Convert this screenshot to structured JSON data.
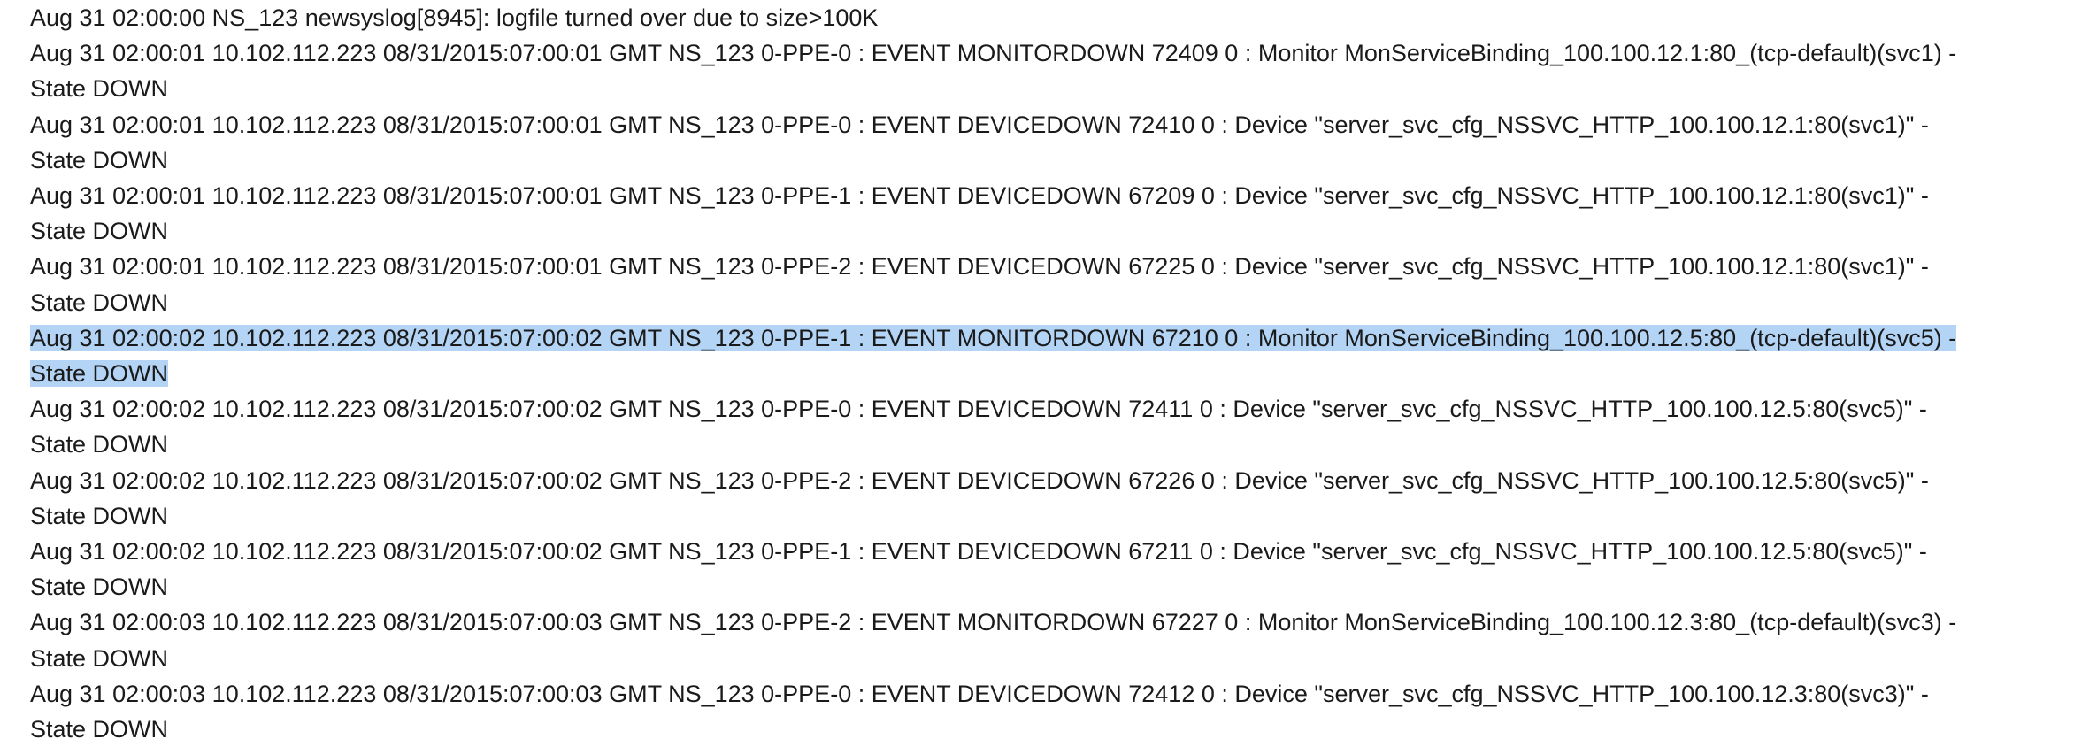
{
  "log": {
    "entries": [
      {
        "text": "Aug 31 02:00:00 NS_123 newsyslog[8945]: logfile turned over due to size>100K",
        "cont": "",
        "selected": false
      },
      {
        "text": "Aug 31 02:00:01 10.102.112.223 08/31/2015:07:00:01 GMT NS_123 0-PPE-0 : EVENT MONITORDOWN 72409 0 : Monitor MonServiceBinding_100.100.12.1:80_(tcp-default)(svc1) -",
        "cont": "State DOWN",
        "selected": false
      },
      {
        "text": "Aug 31 02:00:01 10.102.112.223 08/31/2015:07:00:01 GMT NS_123 0-PPE-0 : EVENT DEVICEDOWN 72410 0 : Device \"server_svc_cfg_NSSVC_HTTP_100.100.12.1:80(svc1)\" -",
        "cont": "State DOWN",
        "selected": false
      },
      {
        "text": "Aug 31 02:00:01 10.102.112.223 08/31/2015:07:00:01 GMT NS_123 0-PPE-1 : EVENT DEVICEDOWN 67209 0 : Device \"server_svc_cfg_NSSVC_HTTP_100.100.12.1:80(svc1)\" -",
        "cont": "State DOWN",
        "selected": false
      },
      {
        "text": "Aug 31 02:00:01 10.102.112.223 08/31/2015:07:00:01 GMT NS_123 0-PPE-2 : EVENT DEVICEDOWN 67225 0 : Device \"server_svc_cfg_NSSVC_HTTP_100.100.12.1:80(svc1)\" -",
        "cont": "State DOWN",
        "selected": false
      },
      {
        "text": "Aug 31 02:00:02 10.102.112.223 08/31/2015:07:00:02 GMT NS_123 0-PPE-1 : EVENT MONITORDOWN 67210 0 : Monitor MonServiceBinding_100.100.12.5:80_(tcp-default)(svc5) -",
        "cont": "State DOWN",
        "selected": true
      },
      {
        "text": "Aug 31 02:00:02 10.102.112.223 08/31/2015:07:00:02 GMT NS_123 0-PPE-0 : EVENT DEVICEDOWN 72411 0 : Device \"server_svc_cfg_NSSVC_HTTP_100.100.12.5:80(svc5)\" -",
        "cont": "State DOWN",
        "selected": false
      },
      {
        "text": "Aug 31 02:00:02 10.102.112.223 08/31/2015:07:00:02 GMT NS_123 0-PPE-2 : EVENT DEVICEDOWN 67226 0 : Device \"server_svc_cfg_NSSVC_HTTP_100.100.12.5:80(svc5)\" -",
        "cont": "State DOWN",
        "selected": false
      },
      {
        "text": "Aug 31 02:00:02 10.102.112.223 08/31/2015:07:00:02 GMT NS_123 0-PPE-1 : EVENT DEVICEDOWN 67211 0 : Device \"server_svc_cfg_NSSVC_HTTP_100.100.12.5:80(svc5)\" -",
        "cont": "State DOWN",
        "selected": false
      },
      {
        "text": "Aug 31 02:00:03 10.102.112.223 08/31/2015:07:00:03 GMT NS_123 0-PPE-2 : EVENT MONITORDOWN 67227 0 : Monitor MonServiceBinding_100.100.12.3:80_(tcp-default)(svc3) -",
        "cont": "State DOWN",
        "selected": false
      },
      {
        "text": "Aug 31 02:00:03 10.102.112.223 08/31/2015:07:00:03 GMT NS_123 0-PPE-0 : EVENT DEVICEDOWN 72412 0 : Device \"server_svc_cfg_NSSVC_HTTP_100.100.12.3:80(svc3)\" -",
        "cont": "State DOWN",
        "selected": false
      }
    ],
    "highlight_color": "#b3d4f5",
    "text_color": "#1a1a1a"
  }
}
